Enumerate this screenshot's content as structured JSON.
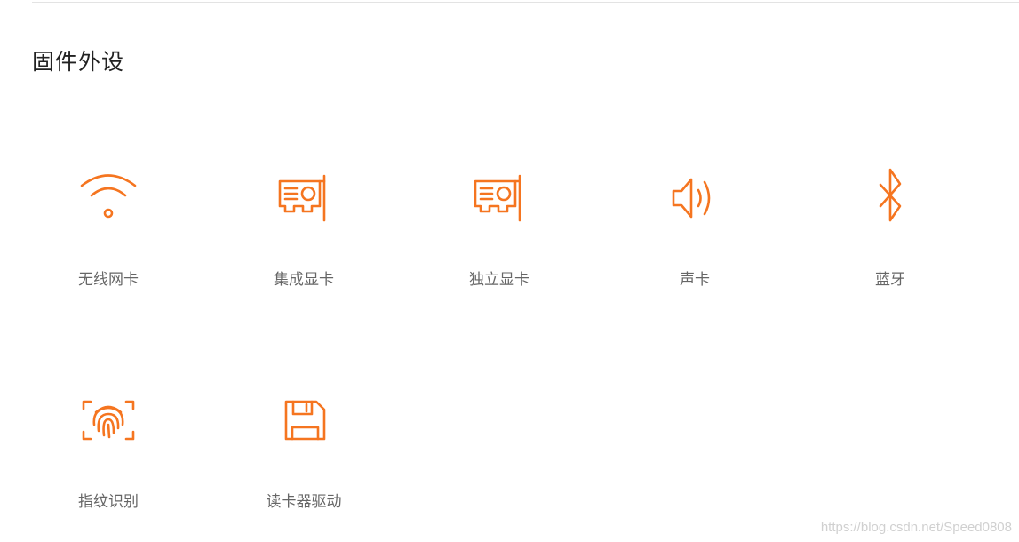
{
  "section": {
    "title": "固件外设"
  },
  "accent_color": "#f57520",
  "items": [
    {
      "label": "无线网卡",
      "icon": "wifi-icon"
    },
    {
      "label": "集成显卡",
      "icon": "graphics-card-icon"
    },
    {
      "label": "独立显卡",
      "icon": "graphics-card-icon"
    },
    {
      "label": "声卡",
      "icon": "speaker-icon"
    },
    {
      "label": "蓝牙",
      "icon": "bluetooth-icon"
    },
    {
      "label": "指纹识别",
      "icon": "fingerprint-icon"
    },
    {
      "label": "读卡器驱动",
      "icon": "floppy-disk-icon"
    }
  ],
  "watermark": "https://blog.csdn.net/Speed0808"
}
